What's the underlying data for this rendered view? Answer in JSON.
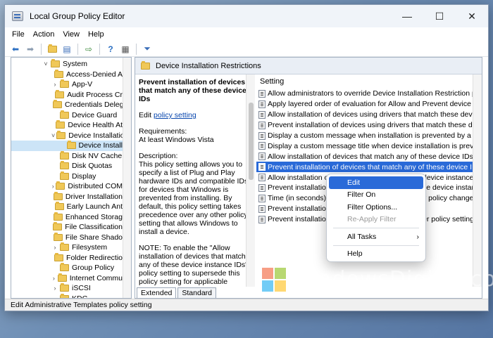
{
  "window": {
    "title": "Local Group Policy Editor",
    "controls": [
      "—",
      "☐",
      "✕"
    ]
  },
  "menu": [
    "File",
    "Action",
    "View",
    "Help"
  ],
  "toolbar_icons": [
    "back-arrow-icon",
    "forward-arrow-icon",
    "up-folder-icon",
    "show-hide-tree-icon",
    "export-list-icon",
    "help-icon",
    "properties-icon",
    "filter-icon"
  ],
  "tree": {
    "items": [
      {
        "label": "System",
        "indent": 0,
        "exp": "˅"
      },
      {
        "label": "Access-Denied A",
        "indent": 1,
        "exp": ""
      },
      {
        "label": "App-V",
        "indent": 1,
        "exp": "›"
      },
      {
        "label": "Audit Process Cr",
        "indent": 1,
        "exp": ""
      },
      {
        "label": "Credentials Deleg",
        "indent": 1,
        "exp": ""
      },
      {
        "label": "Device Guard",
        "indent": 1,
        "exp": ""
      },
      {
        "label": "Device Health At",
        "indent": 1,
        "exp": ""
      },
      {
        "label": "Device Installatio",
        "indent": 1,
        "exp": "˅"
      },
      {
        "label": "Device Install",
        "indent": 2,
        "exp": "",
        "selected": true
      },
      {
        "label": "Disk NV Cache",
        "indent": 1,
        "exp": ""
      },
      {
        "label": "Disk Quotas",
        "indent": 1,
        "exp": ""
      },
      {
        "label": "Display",
        "indent": 1,
        "exp": ""
      },
      {
        "label": "Distributed COM",
        "indent": 1,
        "exp": "›"
      },
      {
        "label": "Driver Installation",
        "indent": 1,
        "exp": ""
      },
      {
        "label": "Early Launch Ant",
        "indent": 1,
        "exp": ""
      },
      {
        "label": "Enhanced Storag",
        "indent": 1,
        "exp": ""
      },
      {
        "label": "File Classification",
        "indent": 1,
        "exp": ""
      },
      {
        "label": "File Share Shado",
        "indent": 1,
        "exp": ""
      },
      {
        "label": "Filesystem",
        "indent": 1,
        "exp": "›"
      },
      {
        "label": "Folder Redirectio",
        "indent": 1,
        "exp": ""
      },
      {
        "label": "Group Policy",
        "indent": 1,
        "exp": ""
      },
      {
        "label": "Internet Commu",
        "indent": 1,
        "exp": "›"
      },
      {
        "label": "iSCSI",
        "indent": 1,
        "exp": "›"
      },
      {
        "label": "KDC",
        "indent": 1,
        "exp": ""
      }
    ]
  },
  "panel": {
    "header": "Device Installation Restrictions",
    "desc_title": "Prevent installation of devices that match any of these device IDs",
    "edit_prefix": "Edit ",
    "edit_link": "policy setting",
    "requirements": "Requirements:",
    "requirements_value": "At least Windows Vista",
    "description_label": "Description:",
    "description": "This policy setting allows you to specify a list of Plug and Play hardware IDs and compatible IDs for devices that Windows is prevented from installing. By default, this policy setting takes precedence over any other policy setting that allows Windows to install a device.",
    "note": "NOTE: To enable the \"Allow installation of devices that match any of these device instance IDs\" policy setting to supersede this policy setting for applicable devices, enable the \"Apply layered order of evaluation for Allow and Prevent device installation policies"
  },
  "list": {
    "header": "Setting",
    "items": [
      "Allow administrators to override Device Installation Restriction policies",
      "Apply layered order of evaluation for Allow and Prevent device installa...",
      "Allow installation of devices using drivers that match these device setu...",
      "Prevent installation of devices using drivers that match these device se...",
      "Display a custom message when installation is prevented by a policy s...",
      "Display a custom message title when device installation is prevented b...",
      "Allow installation of devices that match any of these device IDs",
      "Prevent installation of devices that match any of these device IDs",
      "Allow installation o",
      "Prevent installation",
      "Time (in seconds) t",
      "Prevent installation",
      "Prevent installation"
    ],
    "peek": {
      "8": "device instance IDs",
      "9": "se device instance...",
      "10": "y policy changes to ...",
      "12": "er policy settings"
    },
    "selected_index": 7
  },
  "tabs": [
    "Extended",
    "Standard"
  ],
  "status": "Edit Administrative Templates policy setting",
  "context_menu": {
    "items": [
      {
        "label": "Edit",
        "state": "highlight"
      },
      {
        "label": "Filter On",
        "state": "normal"
      },
      {
        "label": "Filter Options...",
        "state": "normal"
      },
      {
        "label": "Re-Apply Filter",
        "state": "disabled"
      },
      {
        "sep": true
      },
      {
        "label": "All Tasks",
        "state": "normal",
        "submenu": true
      },
      {
        "sep": true
      },
      {
        "label": "Help",
        "state": "normal"
      }
    ]
  },
  "watermark": "WindowsDigital.com",
  "colors": {
    "selection": "#2a6ad8",
    "tree_selection": "#cce4f7",
    "folder": "#f0c858"
  }
}
